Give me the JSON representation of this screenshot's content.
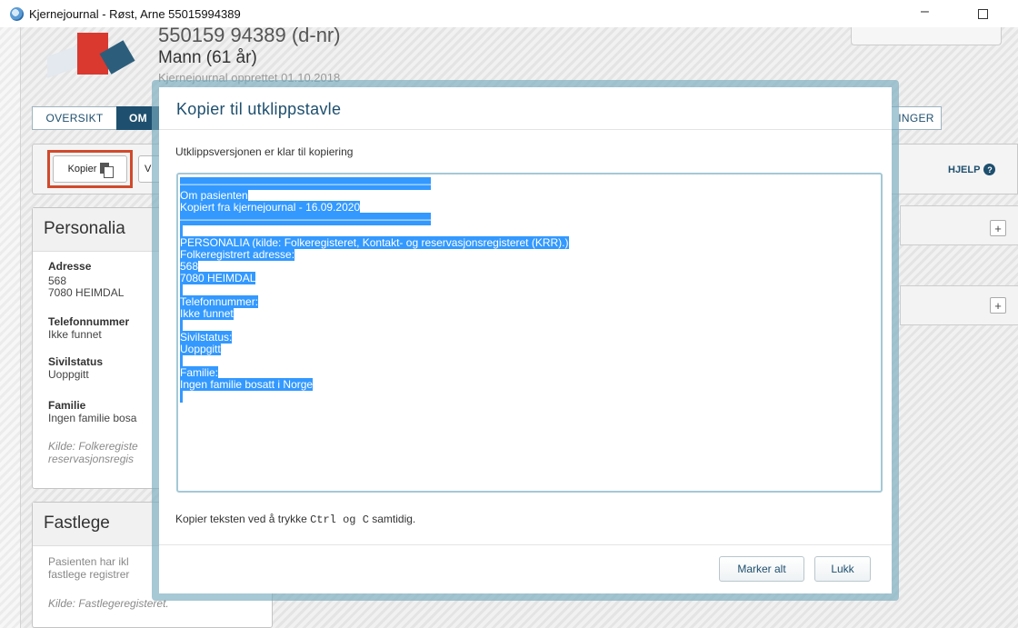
{
  "window": {
    "title": "Kjernejournal - Røst, Arne 55015994389",
    "minimize": "–"
  },
  "patient": {
    "id_line": "550159 94389 (d-nr)",
    "sex_age": "Mann (61 år)",
    "created": "Kjernejournal opprettet 01.10.2018"
  },
  "tabs": {
    "oversikt": "OVERSIKT",
    "om": "OM",
    "inger": "INGER"
  },
  "toolbar": {
    "kopier_label": "Kopier",
    "v_label": "V",
    "help_label": "HJELP",
    "help_icon_glyph": "?"
  },
  "personalia": {
    "title": "Personalia",
    "address_label": "Adresse",
    "address_line1": "568",
    "address_line2": "7080 HEIMDAL",
    "phone_label": "Telefonnummer",
    "phone_value": "Ikke funnet",
    "civil_label": "Sivilstatus",
    "civil_value": "Uoppgitt",
    "family_label": "Familie",
    "family_value": "Ingen familie bosa",
    "source_line1": "Kilde: Folkeregiste",
    "source_line2": "reservasjonsregis"
  },
  "fastlege": {
    "title": "Fastlege",
    "text_line1": "Pasienten har ikl",
    "text_line2": "fastlege registrer",
    "source": "Kilde: Fastlegeregisteret."
  },
  "right": {
    "plus1": "+",
    "plus2": "+"
  },
  "dialog": {
    "title": "Kopier til utklippstavle",
    "message": "Utklippsversjonen er klar til kopiering",
    "hint_pre": "Kopier teksten ved å trykke ",
    "hint_key1": "Ctrl",
    "hint_mid": " og ",
    "hint_key2": "C",
    "hint_post": " samtidig.",
    "btn_select_all": "Marker alt",
    "btn_close": "Lukk",
    "text_lines": [
      "———————————————————————",
      "Om pasienten",
      "Kopiert fra kjernejournal - 16.09.2020",
      "———————————————————————",
      " ",
      "PERSONALIA (kilde: Folkeregisteret, Kontakt- og reservasjonsregisteret (KRR).)",
      "Folkeregistrert adresse:",
      "568",
      "7080 HEIMDAL",
      " ",
      "Telefonnummer:",
      "Ikke funnet",
      " ",
      "Sivilstatus:",
      "Uoppgitt",
      " ",
      "Familie:",
      "Ingen familie bosatt i Norge",
      " "
    ]
  },
  "colors": {
    "brand_red": "#d9392f",
    "brand_navy": "#1e4f6e",
    "selection": "#3399ff",
    "highlight_box": "#d04a2c"
  }
}
